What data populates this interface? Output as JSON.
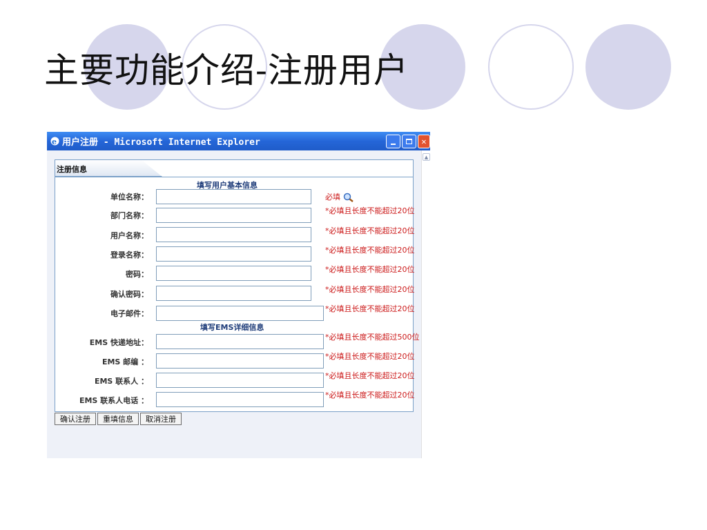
{
  "slide": {
    "title": "主要功能介绍-注册用户"
  },
  "window": {
    "title": "用户注册 - Microsoft Internet Explorer",
    "icon": "ie-icon",
    "controls": [
      "minimize-icon",
      "maximize-icon",
      "close-icon"
    ]
  },
  "panel": {
    "tab_label": "注册信息",
    "section_basic": "填写用户基本信息",
    "section_ems": "填写EMS详细信息"
  },
  "fields": [
    {
      "label": "单位名称：",
      "value": "",
      "note": "必填"
    },
    {
      "label": "部门名称：",
      "value": "",
      "note": "*必填且长度不能超过20位"
    },
    {
      "label": "用户名称：",
      "value": "",
      "note": "*必填且长度不能超过20位"
    },
    {
      "label": "登录名称：",
      "value": "",
      "note": "*必填且长度不能超过20位"
    },
    {
      "label": "密码：",
      "value": "",
      "note": "*必填且长度不能超过20位"
    },
    {
      "label": "确认密码：",
      "value": "",
      "note": "*必填且长度不能超过20位"
    },
    {
      "label": "电子邮件：",
      "value": "",
      "note": "*必填且长度不能超过20位"
    }
  ],
  "ems_fields": [
    {
      "label": "EMS 快递地址：",
      "value": "",
      "note": "*必填且长度不能超过500位"
    },
    {
      "label": "EMS 邮编 ：",
      "value": "",
      "note": "*必填且长度不能超过20位"
    },
    {
      "label": "EMS 联系人 ：",
      "value": "",
      "note": "*必填且长度不能超过20位"
    },
    {
      "label": "EMS 联系人电话 ：",
      "value": "",
      "note": "*必填且长度不能超过20位"
    }
  ],
  "buttons": {
    "confirm": "确认注册",
    "reset": "重填信息",
    "cancel": "取消注册"
  },
  "colors": {
    "decor": "#d6d6ec",
    "titlebar": "#2566d8",
    "required": "#cc1a1a"
  }
}
